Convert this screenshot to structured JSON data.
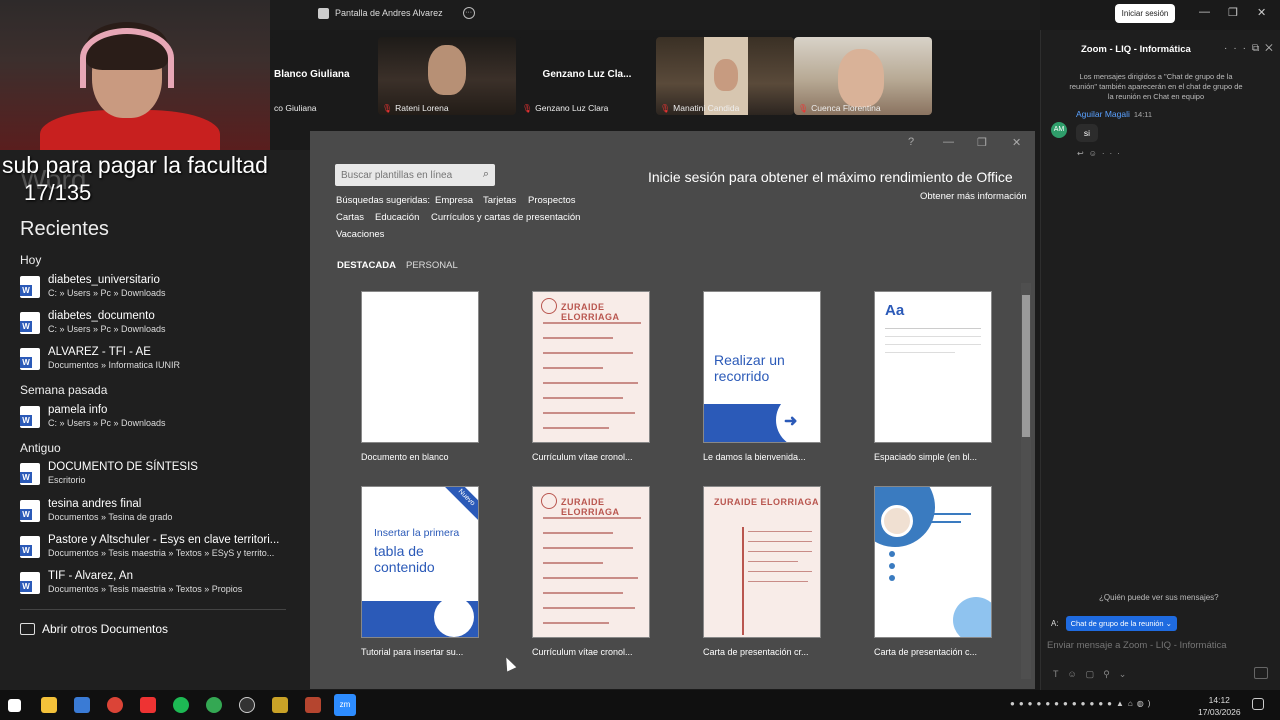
{
  "zoom": {
    "tab_title": "Pantalla de Andres Alvarez",
    "signin_button": "Iniciar sesión",
    "participants": [
      {
        "big_name": "Blanco Giuliana",
        "label": "co Giuliana"
      },
      {
        "big_name": "",
        "label": "Rateni Lorena"
      },
      {
        "big_name": "Genzano  Luz  Cla...",
        "label": "Genzano Luz Clara"
      },
      {
        "big_name": "",
        "label": "Manatini Candida"
      },
      {
        "big_name": "",
        "label": "Cuenca Florentina"
      }
    ]
  },
  "overlay": {
    "caption": "sub para pagar la facultad",
    "ghost": "Word",
    "count": "17/135"
  },
  "word": {
    "recent_heading": "Recientes",
    "groups": {
      "today": "Hoy",
      "last_week": "Semana pasada",
      "older": "Antiguo"
    },
    "docs": [
      {
        "title": "diabetes_universitario",
        "path": "C: » Users » Pc » Downloads"
      },
      {
        "title": "diabetes_documento",
        "path": "C: » Users » Pc » Downloads"
      },
      {
        "title": "ALVAREZ - TFI - AE",
        "path": "Documentos » Informatica IUNIR"
      },
      {
        "title": "pamela info",
        "path": "C: » Users » Pc » Downloads"
      },
      {
        "title": "DOCUMENTO DE SÍNTESIS",
        "path": "Escritorio"
      },
      {
        "title": "tesina andres final",
        "path": "Documentos » Tesina de grado"
      },
      {
        "title": "Pastore y Altschuler - Esys en clave territori...",
        "path": "Documentos » Tesis maestria » Textos » ESyS y territo..."
      },
      {
        "title": "TIF - Alvarez, An",
        "path": "Documentos » Tesis maestria » Textos » Propios"
      }
    ],
    "open_other": "Abrir otros Documentos",
    "dialog": {
      "search_placeholder": "Buscar plantillas en línea",
      "suggested_label": "Búsquedas sugeridas:",
      "suggestions": [
        "Empresa",
        "Tarjetas",
        "Prospectos",
        "Cartas",
        "Educación",
        "Currículos y cartas de presentación",
        "Vacaciones"
      ],
      "signin_message": "Inicie sesión para obtener el máximo rendimiento de Office",
      "more_info": "Obtener más información",
      "tabs": [
        "DESTACADA",
        "PERSONAL"
      ],
      "templates": [
        "Documento en blanco",
        "Currículum vítae cronol...",
        "Le damos la bienvenida...",
        "Espaciado simple (en bl...",
        "Tutorial para insertar su...",
        "Currículum vítae cronol...",
        "Carta de presentación cr...",
        "Carta de presentación c..."
      ],
      "thumb_texts": {
        "tour": "Realizar un recorrido",
        "aa": "Aa",
        "toc": "Insertar la primera",
        "toc_big": "tabla de contenido",
        "new_badge": "Nuevo",
        "resume_name": "ZURAIDE ELORRIAGA"
      }
    }
  },
  "chat": {
    "title": "Zoom - LIQ - Informática",
    "notice": "Los mensajes dirigidos a \"Chat de grupo de la reunión\" también aparecerán en el chat de grupo de la reunión en Chat en equipo",
    "avatar": "AM",
    "sender": "Aguilar Magali",
    "time": "14:11",
    "message": "si",
    "who_can_see": "¿Quién puede ver sus mensajes?",
    "to_label": "A:",
    "to_value": "Chat de grupo de la reunión",
    "input_placeholder": "Enviar mensaje a Zoom - LIQ - Informática"
  },
  "taskbar": {
    "time": "14:12",
    "date": "17/03/2026",
    "zoom_label": "zm"
  }
}
